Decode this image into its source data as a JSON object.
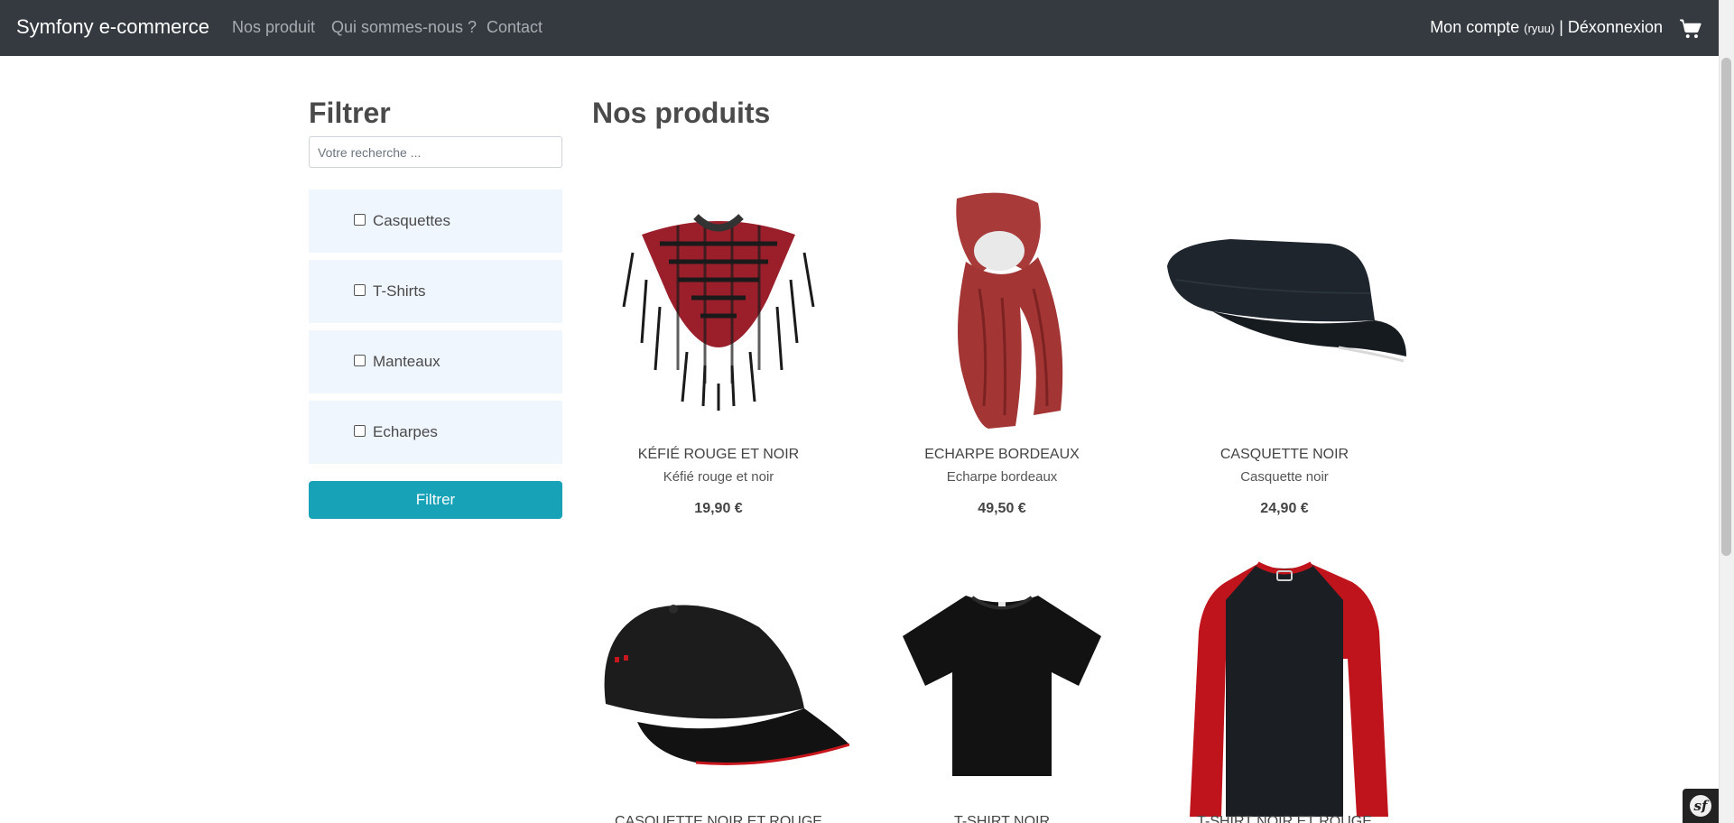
{
  "navbar": {
    "brand": "Symfony e-commerce",
    "links": [
      "Nos produit",
      "Qui sommes-nous ?",
      "Contact"
    ],
    "account_label": "Mon compte",
    "account_user": "(ryuu)",
    "separator": "|",
    "logout_label": "Déxonnexion",
    "cart_icon": "cart-icon"
  },
  "sidebar": {
    "title": "Filtrer",
    "search_placeholder": "Votre recherche ...",
    "categories": [
      "Casquettes",
      "T-Shirts",
      "Manteaux",
      "Echarpes"
    ],
    "filter_button": "Filtrer"
  },
  "main": {
    "title": "Nos produits",
    "products": [
      {
        "name": "KÉFIÉ ROUGE ET NOIR",
        "desc": "Kéfié rouge et noir",
        "price": "19,90 €"
      },
      {
        "name": "ECHARPE BORDEAUX",
        "desc": "Echarpe bordeaux",
        "price": "49,50 €"
      },
      {
        "name": "CASQUETTE NOIR",
        "desc": "Casquette noir",
        "price": "24,90 €"
      },
      {
        "name": "CASQUETTE NOIR ET ROUGE",
        "desc": "",
        "price": ""
      },
      {
        "name": "T-SHIRT NOIR",
        "desc": "",
        "price": ""
      },
      {
        "name": "T-SHIRT NOIR ET ROUGE",
        "desc": "",
        "price": ""
      }
    ]
  },
  "colors": {
    "navbar_bg": "#343a40",
    "button_bg": "#17a2b8",
    "category_bg": "#f0f6fe"
  }
}
